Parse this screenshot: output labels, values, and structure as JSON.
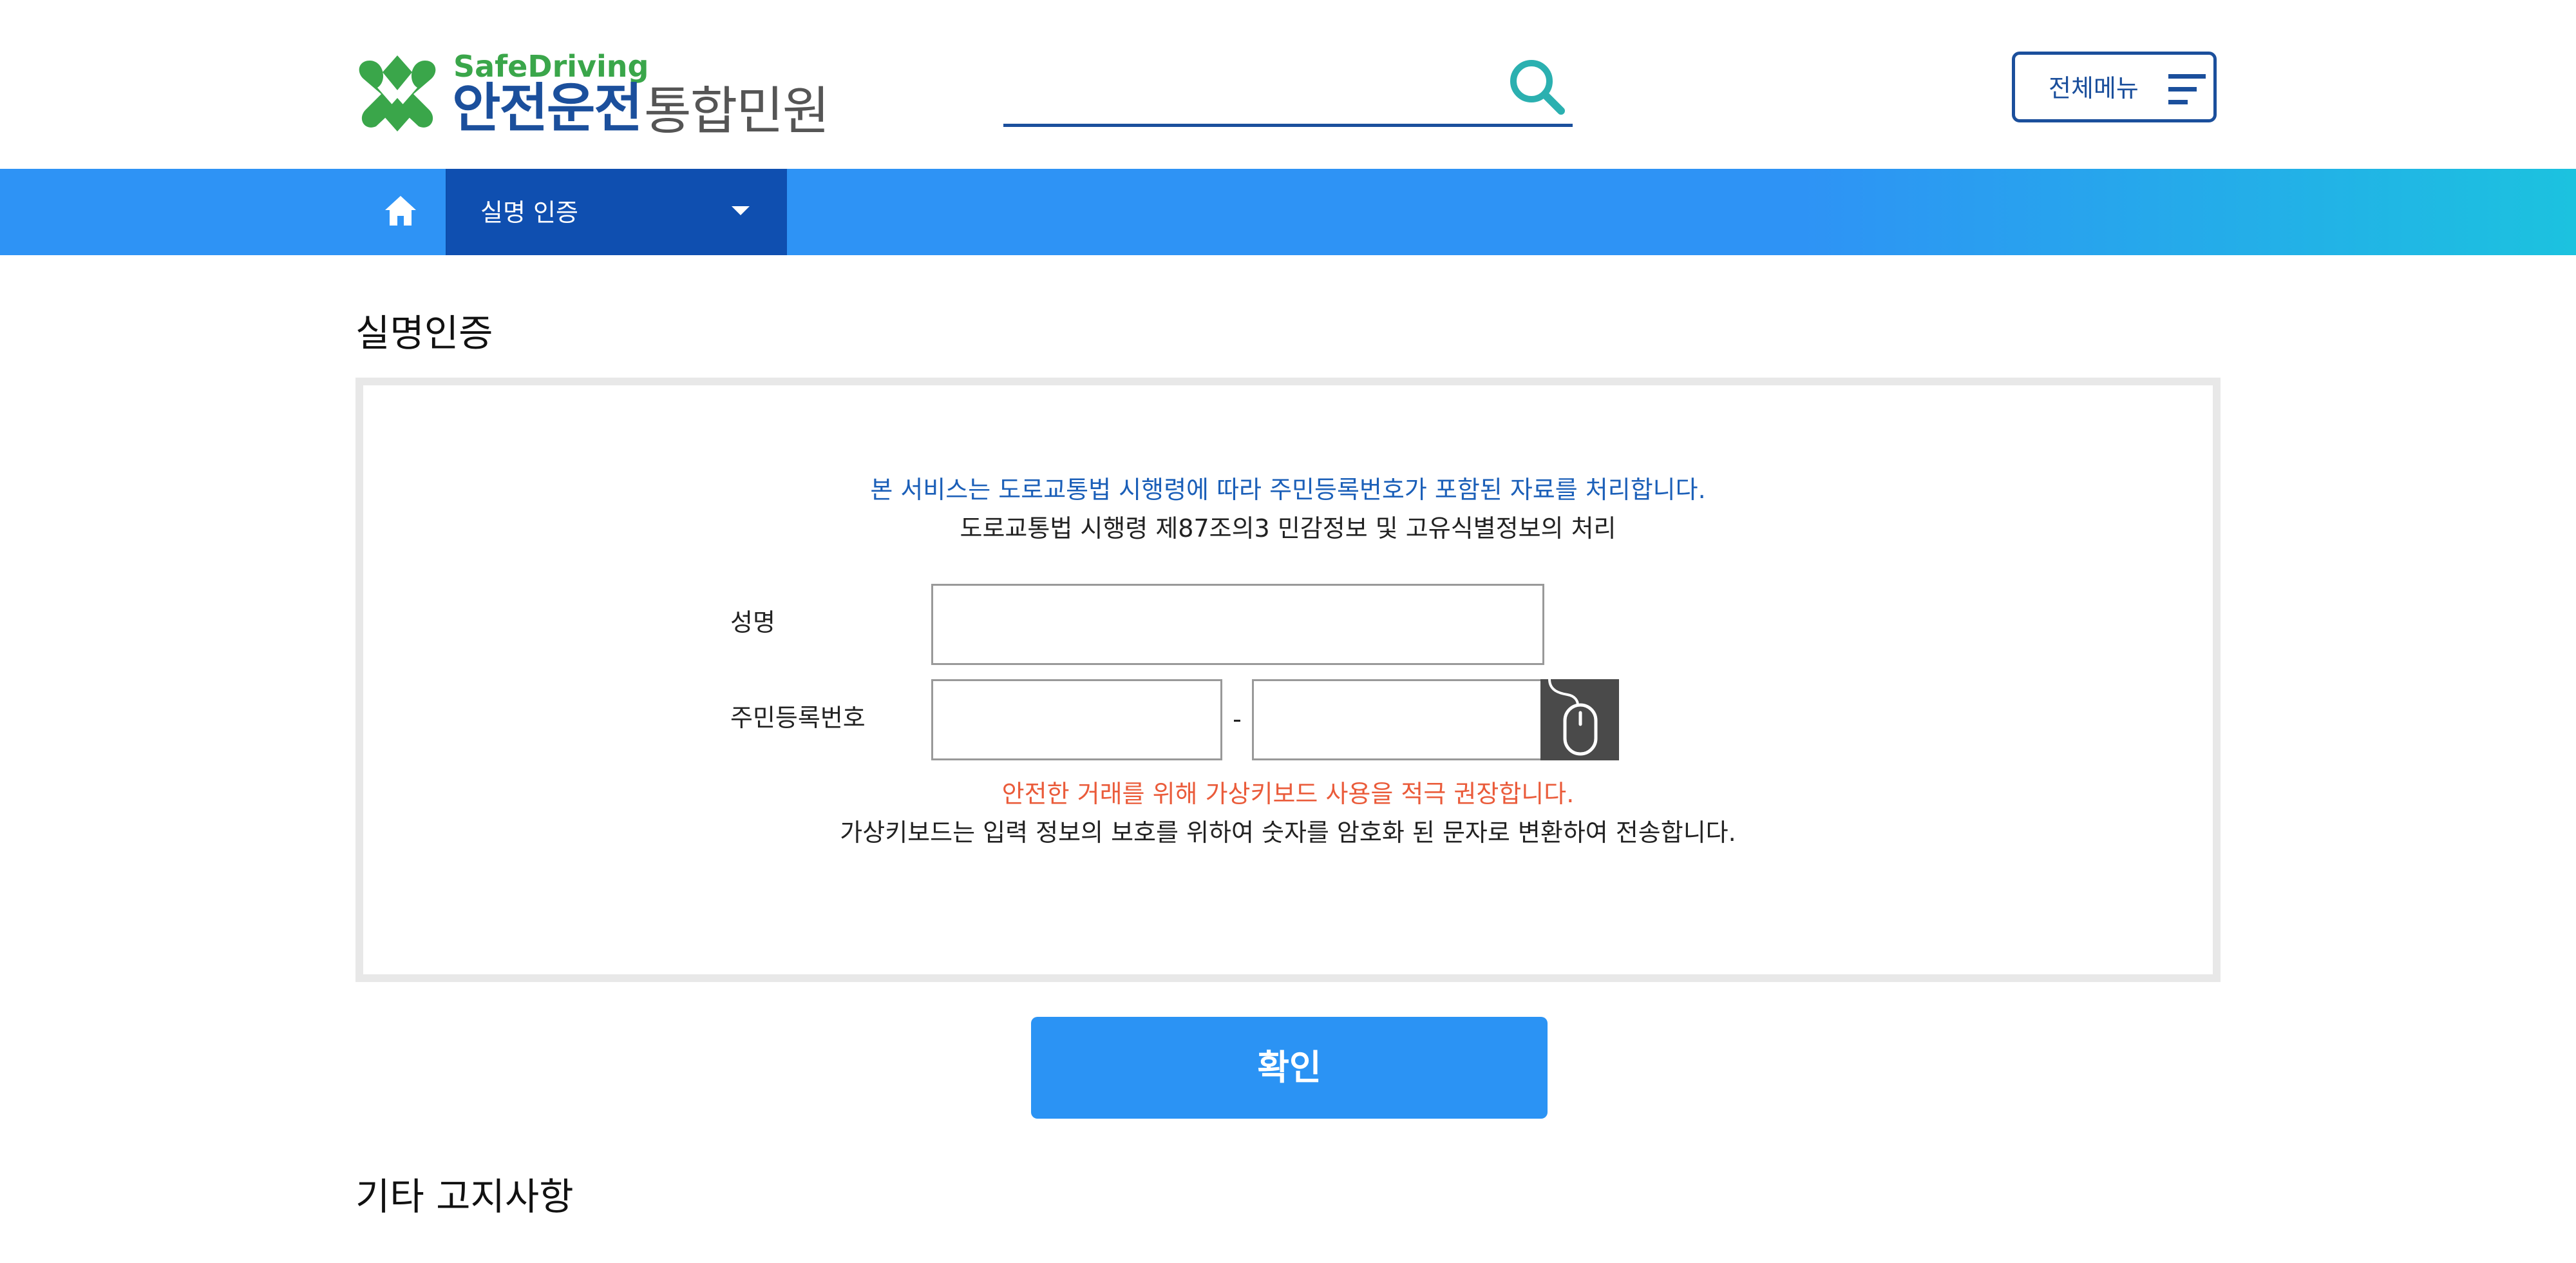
{
  "logo": {
    "sub": "SafeDriving",
    "main": "안전운전",
    "suffix": "통합민원"
  },
  "header": {
    "search_value": "",
    "all_menu_label": "전체메뉴"
  },
  "nav": {
    "breadcrumb_label": "실명 인증"
  },
  "page": {
    "title": "실명인증",
    "notice_primary": "본 서비스는 도로교통법 시행령에 따라 주민등록번호가 포함된 자료를 처리합니다.",
    "notice_secondary": "도로교통법 시행령 제87조의3 민감정보 및 고유식별정보의 처리",
    "form": {
      "name_label": "성명",
      "name_value": "",
      "rrn_label": "주민등록번호",
      "rrn_front_value": "",
      "rrn_dash": "-",
      "rrn_back_value": ""
    },
    "vkbd_warning": "안전한 거래를 위해 가상키보드 사용을 적극 권장합니다.",
    "vkbd_info": "가상키보드는 입력 정보의 보호를 위하여 숫자를 암호화 된 문자로 변환하여 전송합니다.",
    "confirm_label": "확인",
    "other_notices_title": "기타 고지사항"
  },
  "colors": {
    "brand_blue": "#1b4f9c",
    "brand_green": "#3aa64a",
    "nav_blue": "#2e93f5",
    "nav_dark": "#0f4fb0",
    "warning_red": "#ea5b3a",
    "confirm_blue": "#2b93f4"
  },
  "icons": {
    "logo": "clover-logo-icon",
    "search": "search-icon",
    "menu": "hamburger-icon",
    "home": "home-icon",
    "dropdown": "chevron-down-icon",
    "virtual_keyboard": "mouse-icon"
  }
}
